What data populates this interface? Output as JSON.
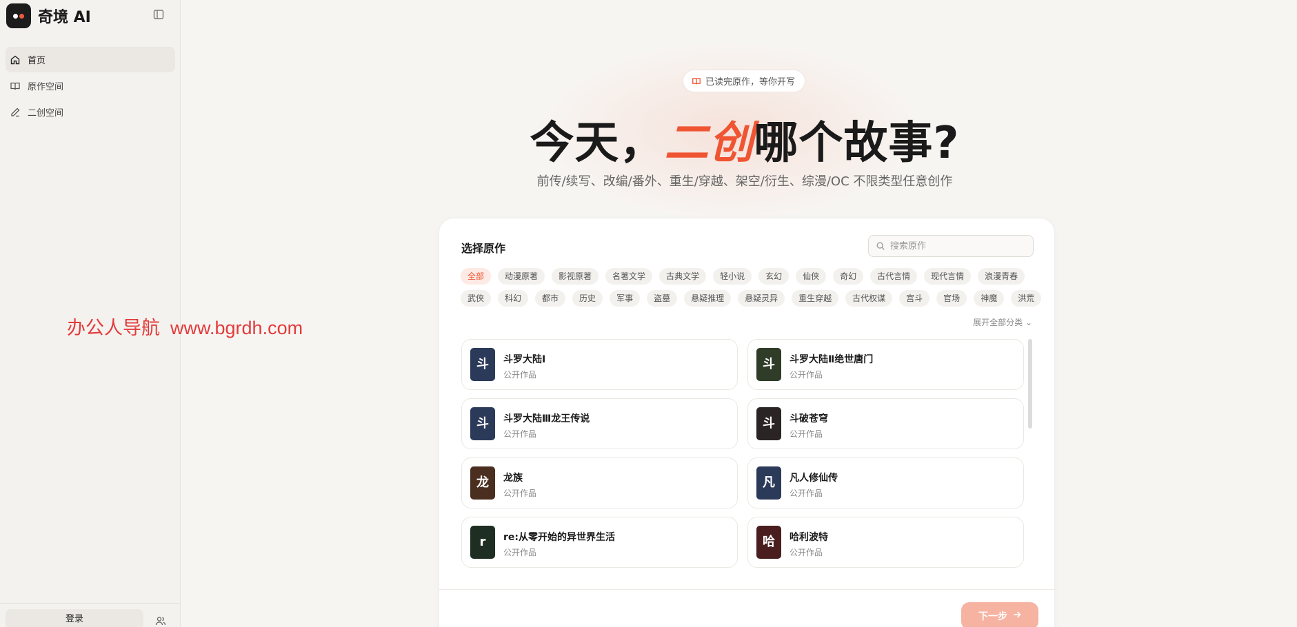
{
  "app": {
    "name": "奇境 AI"
  },
  "sidebar": {
    "items": [
      {
        "label": "首页",
        "icon": "home-icon",
        "active": true
      },
      {
        "label": "原作空间",
        "icon": "book-icon",
        "active": false
      },
      {
        "label": "二创空间",
        "icon": "pencil-icon",
        "active": false
      }
    ],
    "login_label": "登录"
  },
  "watermark": "办公人导航  www.bgrdh.com",
  "hero": {
    "pill": "已读完原作，等你开写",
    "title_before": "今天，",
    "title_accent": "二创",
    "title_after": "哪个故事?",
    "subtitle": "前传/续写、改编/番外、重生/穿越、架空/衍生、综漫/OC 不限类型任意创作"
  },
  "picker": {
    "title": "选择原作",
    "search_placeholder": "搜索原作",
    "tags_row1": [
      "全部",
      "动漫原著",
      "影视原著",
      "名著文学",
      "古典文学",
      "轻小说",
      "玄幻",
      "仙侠",
      "奇幻",
      "古代言情",
      "现代言情",
      "浪漫青春"
    ],
    "tags_row2": [
      "武侠",
      "科幻",
      "都市",
      "历史",
      "军事",
      "盗墓",
      "悬疑推理",
      "悬疑灵异",
      "重生穿越",
      "古代权谋",
      "宫斗",
      "官场",
      "神魔",
      "洪荒"
    ],
    "active_tag": "全部",
    "expand_label": "展开全部分类",
    "works": [
      {
        "cover_char": "斗",
        "title": "斗罗大陆Ⅰ",
        "subtitle": "公开作品",
        "cover_color": "#2c3a5a"
      },
      {
        "cover_char": "斗",
        "title": "斗罗大陆Ⅱ绝世唐门",
        "subtitle": "公开作品",
        "cover_color": "#2f3d28"
      },
      {
        "cover_char": "斗",
        "title": "斗罗大陆Ⅲ龙王传说",
        "subtitle": "公开作品",
        "cover_color": "#2c3a5a"
      },
      {
        "cover_char": "斗",
        "title": "斗破苍穹",
        "subtitle": "公开作品",
        "cover_color": "#2a2424"
      },
      {
        "cover_char": "龙",
        "title": "龙族",
        "subtitle": "公开作品",
        "cover_color": "#4a2e20"
      },
      {
        "cover_char": "凡",
        "title": "凡人修仙传",
        "subtitle": "公开作品",
        "cover_color": "#2c3a5a"
      },
      {
        "cover_char": "r",
        "title": "re:从零开始的异世界生活",
        "subtitle": "公开作品",
        "cover_color": "#1e2e22"
      },
      {
        "cover_char": "哈",
        "title": "哈利波特",
        "subtitle": "公开作品",
        "cover_color": "#4a1e1e"
      }
    ],
    "next_label": "下一步",
    "accent_color": "#ef5533"
  }
}
